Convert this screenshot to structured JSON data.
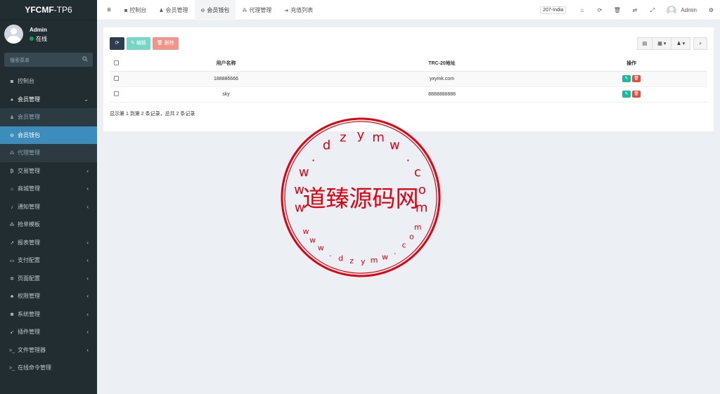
{
  "sidebar": {
    "brand_bold": "YFCMF",
    "brand_light": "-TP6",
    "user": {
      "name": "Admin",
      "status": "在线"
    },
    "search_placeholder": "搜索菜单",
    "items": [
      {
        "label": "控制台",
        "icon": "dashboard-icon",
        "glyph": "◙",
        "arrow": ""
      },
      {
        "label": "会员管理",
        "icon": "user-circle-icon",
        "glyph": "●",
        "arrow": "⌄"
      },
      {
        "label": "会员管理",
        "icon": "user-icon",
        "glyph": "♟",
        "arrow": ""
      },
      {
        "label": "会员钱包",
        "icon": "wallet-icon",
        "glyph": "⊖",
        "arrow": ""
      },
      {
        "label": "代理管理",
        "icon": "sitemap-icon",
        "glyph": "⁂",
        "arrow": ""
      },
      {
        "label": "交易管理",
        "icon": "bitcoin-icon",
        "glyph": "₿",
        "arrow": "‹"
      },
      {
        "label": "商城管理",
        "icon": "home-icon",
        "glyph": "⌂",
        "arrow": "‹"
      },
      {
        "label": "通知管理",
        "icon": "bell-icon",
        "glyph": "♪",
        "arrow": "‹"
      },
      {
        "label": "抢单模板",
        "icon": "sitemap-icon",
        "glyph": "⁂",
        "arrow": ""
      },
      {
        "label": "报表管理",
        "icon": "line-chart-icon",
        "glyph": "↗",
        "arrow": "‹"
      },
      {
        "label": "支付配置",
        "icon": "credit-card-icon",
        "glyph": "▭",
        "arrow": "‹"
      },
      {
        "label": "页面配置",
        "icon": "gear-icon",
        "glyph": "✲",
        "arrow": "‹"
      },
      {
        "label": "权限管理",
        "icon": "users-icon",
        "glyph": "♣",
        "arrow": "‹"
      },
      {
        "label": "系统管理",
        "icon": "gears-icon",
        "glyph": "✱",
        "arrow": "‹"
      },
      {
        "label": "插件管理",
        "icon": "rocket-icon",
        "glyph": "➹",
        "arrow": "‹"
      },
      {
        "label": "文件管理器",
        "icon": "terminal-icon",
        "glyph": ">_",
        "arrow": "‹"
      },
      {
        "label": "在线命令管理",
        "icon": "terminal-icon",
        "glyph": ">_",
        "arrow": ""
      }
    ]
  },
  "topbar": {
    "tabs": [
      {
        "label": "控制台",
        "glyph": "◙"
      },
      {
        "label": "会员管理",
        "glyph": "♟"
      },
      {
        "label": "会员钱包",
        "glyph": "⊖"
      },
      {
        "label": "代理管理",
        "glyph": "⁂"
      },
      {
        "label": "充值列表",
        "glyph": "➜"
      }
    ],
    "language": "207-India",
    "admin_name": "Admin"
  },
  "toolbar": {
    "refresh": "⟳",
    "edit": "编辑",
    "delete": "删除"
  },
  "table": {
    "headers": [
      "用户名称",
      "TRC-20地址",
      "操作"
    ],
    "rows": [
      {
        "username": "188886666",
        "address": "yxymk.com"
      },
      {
        "username": "sky",
        "address": "8888888888"
      }
    ]
  },
  "page_info": "显示第 1 到第 2 条记录，总共 2 条记录",
  "stamp": {
    "center_text": "道臻源码网",
    "outer_text": "www.dzymw.com",
    "inner_text": "www.dzymw.com",
    "color": "#e3000f"
  }
}
